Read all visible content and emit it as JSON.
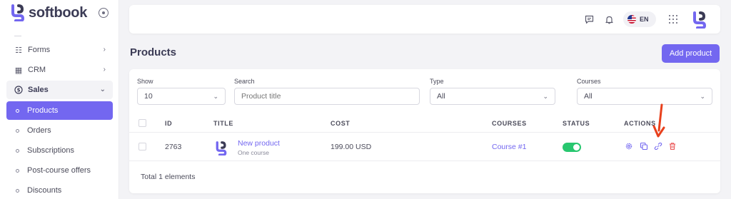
{
  "brand": {
    "name": "softbook"
  },
  "sidebar": {
    "items": [
      {
        "label": "Forms",
        "icon": "list-check-icon"
      },
      {
        "label": "CRM",
        "icon": "grid-icon"
      },
      {
        "label": "Sales",
        "icon": "dollar-circle-icon"
      }
    ],
    "sales_children": [
      {
        "label": "Products"
      },
      {
        "label": "Orders"
      },
      {
        "label": "Subscriptions"
      },
      {
        "label": "Post-course offers"
      },
      {
        "label": "Discounts"
      }
    ]
  },
  "header": {
    "language": "EN"
  },
  "page": {
    "title": "Products",
    "add_button": "Add product"
  },
  "filters": {
    "show": {
      "label": "Show",
      "value": "10"
    },
    "search": {
      "label": "Search",
      "placeholder": "Product title"
    },
    "type": {
      "label": "Type",
      "value": "All"
    },
    "courses": {
      "label": "Courses",
      "value": "All"
    }
  },
  "table": {
    "columns": [
      "ID",
      "TITLE",
      "COST",
      "COURSES",
      "STATUS",
      "ACTIONS"
    ],
    "rows": [
      {
        "id": "2763",
        "title": "New product",
        "subtitle": "One course",
        "cost": "199.00 USD",
        "course": "Course #1",
        "status": true
      }
    ],
    "total_text": "Total 1 elements"
  },
  "colors": {
    "accent": "#7367f0",
    "success": "#28c76f",
    "danger": "#ea5455",
    "annotation_arrow": "#e8401c"
  }
}
